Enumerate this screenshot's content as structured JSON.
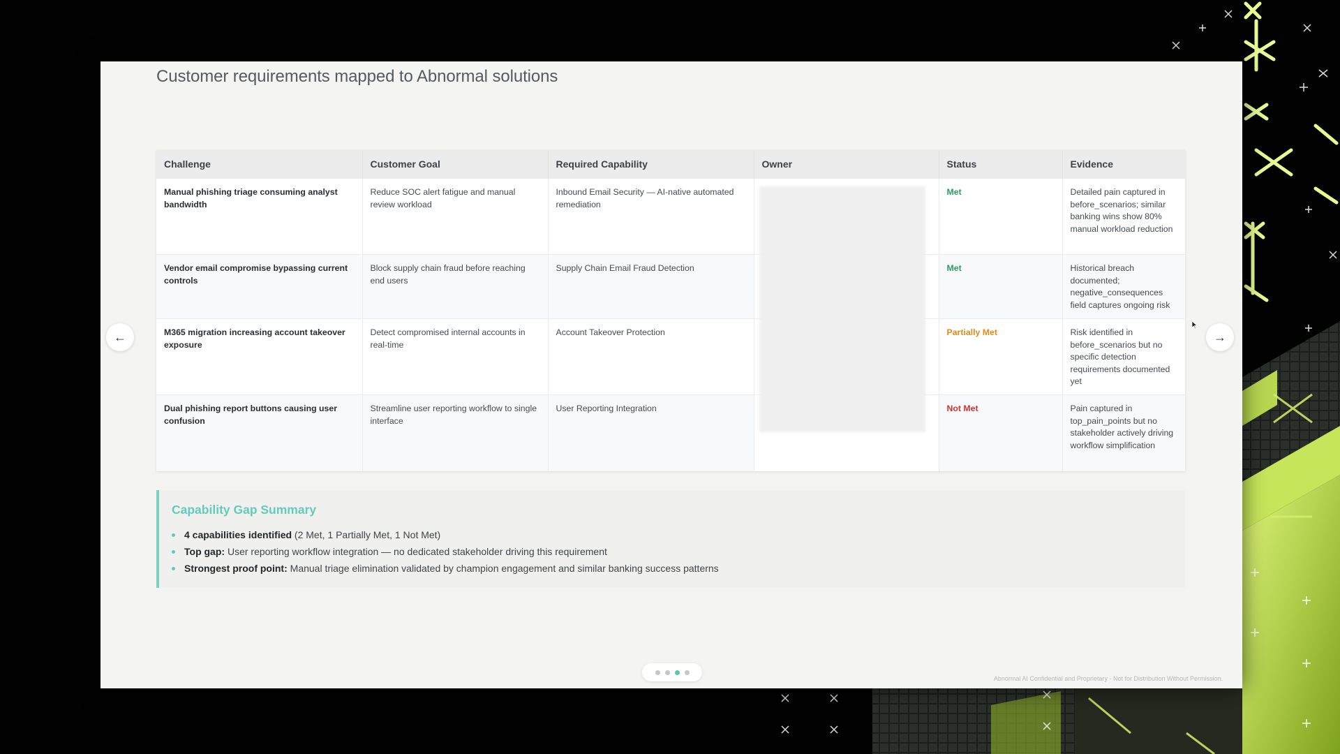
{
  "slide": {
    "title": "Customer requirements mapped to Abnormal solutions",
    "footer": "Abnormal AI Confidential and Proprietary - Not for Distribution Without Permission."
  },
  "table": {
    "headers": [
      "Challenge",
      "Customer Goal",
      "Required Capability",
      "Owner",
      "Status",
      "Evidence"
    ],
    "rows": [
      {
        "challenge": "Manual phishing triage consuming analyst bandwidth",
        "goal": "Reduce SOC alert fatigue and manual review workload",
        "capability": "Inbound Email Security — AI-native automated remediation",
        "owner": "",
        "status": "Met",
        "evidence": "Detailed pain captured in before_scenarios; similar banking wins show 80% manual workload reduction"
      },
      {
        "challenge": "Vendor email compromise bypassing current controls",
        "goal": "Block supply chain fraud before reaching end users",
        "capability": "Supply Chain Email Fraud Detection",
        "owner": "",
        "status": "Met",
        "evidence": "Historical breach documented; negative_consequences field captures ongoing risk"
      },
      {
        "challenge": "M365 migration increasing account takeover exposure",
        "goal": "Detect compromised internal accounts in real-time",
        "capability": "Account Takeover Protection",
        "owner": "",
        "status": "Partially Met",
        "evidence": "Risk identified in before_scenarios but no specific detection requirements documented yet"
      },
      {
        "challenge": "Dual phishing report buttons causing user confusion",
        "goal": "Streamline user reporting workflow to single interface",
        "capability": "User Reporting Integration",
        "owner": "",
        "status": "Not Met",
        "evidence": "Pain captured in top_pain_points but no stakeholder actively driving workflow simplification"
      }
    ]
  },
  "gap_summary": {
    "title": "Capability Gap Summary",
    "items": [
      {
        "bold": "4 capabilities identified",
        "text": " (2 Met, 1 Partially Met, 1 Not Met)"
      },
      {
        "bold": "Top gap:",
        "text": " User reporting workflow integration — no dedicated stakeholder driving this requirement"
      },
      {
        "bold": "Strongest proof point:",
        "text": " Manual triage elimination validated by champion engagement and similar banking success patterns"
      }
    ]
  },
  "nav": {
    "prev_label": "←",
    "next_label": "→"
  },
  "pager": {
    "total": 4,
    "active_index": 2
  },
  "colors": {
    "accent": "#64cbbb",
    "met": "#2e9c64",
    "partially_met": "#e08a18",
    "not_met": "#d23232",
    "background_art": "#d8f56a"
  }
}
